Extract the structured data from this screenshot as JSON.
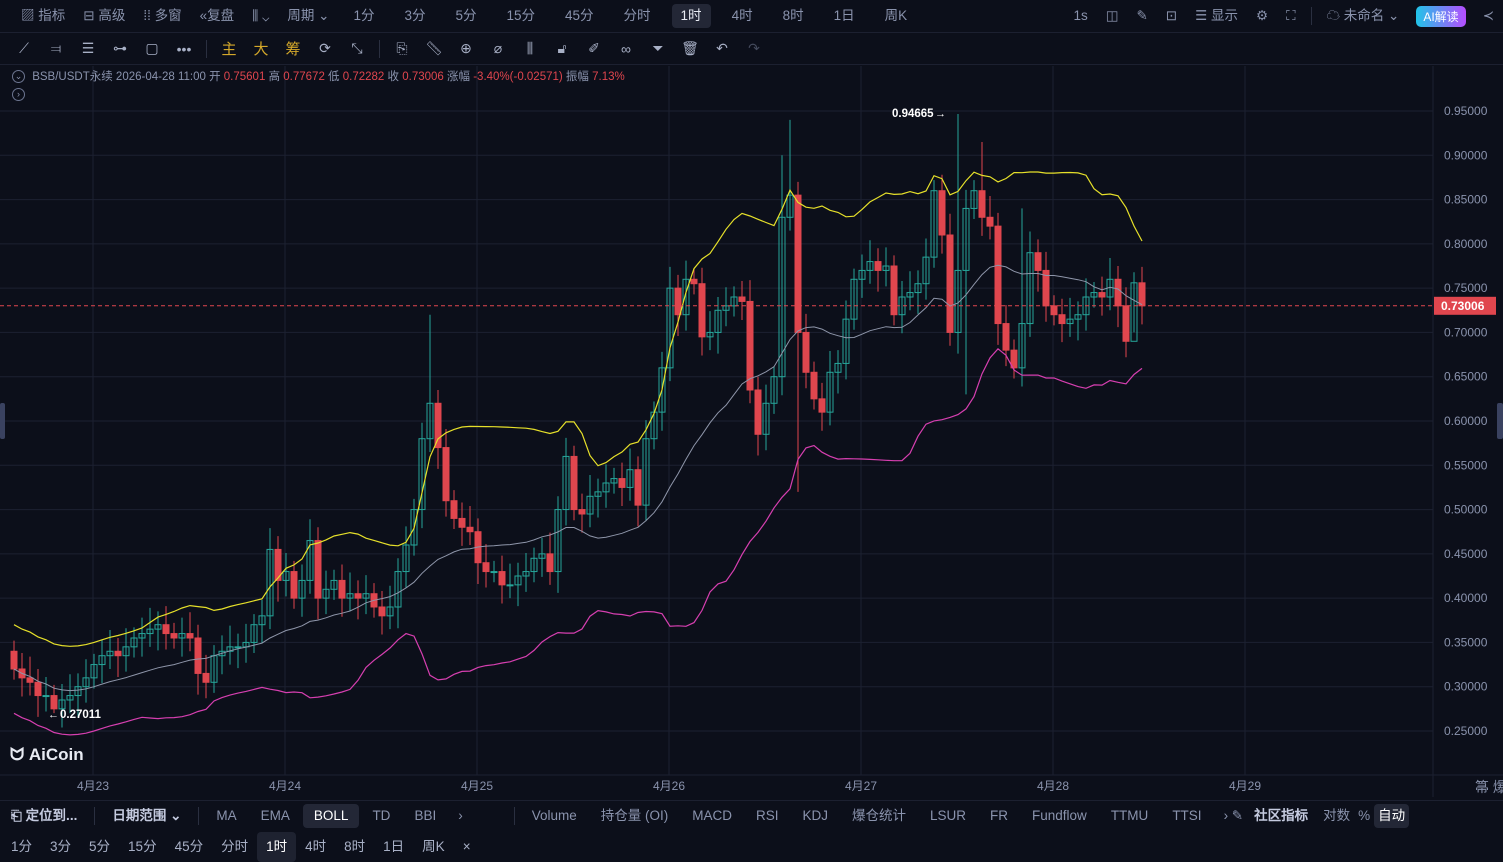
{
  "topbar": {
    "items": [
      "指标",
      "高级",
      "多窗",
      "复盘",
      "周期"
    ],
    "icons": [
      "chart-icon",
      "window-icon",
      "grid-icon",
      "replay-icon",
      "candle-type-icon"
    ],
    "periods": [
      "1分",
      "3分",
      "5分",
      "15分",
      "45分",
      "分时",
      "1时",
      "4时",
      "8时",
      "1日",
      "周K"
    ],
    "active_period": "1时",
    "refresh": "1s",
    "display": "显示",
    "layout_name": "未命名",
    "ai_button": "AI解读"
  },
  "drawing_tools": {
    "main": "主",
    "big": "大",
    "chips": "筹"
  },
  "info": {
    "symbol": "BSB/USDT永续",
    "datetime": "2026-04-28 11:00",
    "open_label": "开",
    "open": "0.75601",
    "high_label": "高",
    "high": "0.77672",
    "low_label": "低",
    "low": "0.72282",
    "close_label": "收",
    "close": "0.73006",
    "change_label": "涨幅",
    "change": "-3.40%(-0.02571)",
    "amp_label": "振幅",
    "amplitude": "7.13%"
  },
  "colors": {
    "up": "#26a69a",
    "down": "#e0464e",
    "boll_upper": "#e6e02a",
    "boll_mid": "#8f96aa",
    "boll_lower": "#d63fb0",
    "bg": "#0c0f1a"
  },
  "chart_data": {
    "type": "candlestick",
    "indicator": "BOLL(20,2)",
    "ylim": [
      0.22,
      0.98
    ],
    "yticks": [
      "0.95000",
      "0.90000",
      "0.85000",
      "0.80000",
      "0.75000",
      "0.70000",
      "0.65000",
      "0.60000",
      "0.55000",
      "0.50000",
      "0.45000",
      "0.40000",
      "0.35000",
      "0.30000",
      "0.25000"
    ],
    "xticks": [
      "4月23",
      "4月24",
      "4月25",
      "4月26",
      "4月27",
      "4月28",
      "4月29"
    ],
    "current_price": "0.73006",
    "max_label": "0.94665",
    "min_label": "0.27011",
    "first_open": 0.34,
    "closes": [
      0.32,
      0.31,
      0.305,
      0.29,
      0.29,
      0.275,
      0.285,
      0.29,
      0.3,
      0.31,
      0.325,
      0.335,
      0.34,
      0.335,
      0.345,
      0.355,
      0.36,
      0.365,
      0.37,
      0.36,
      0.355,
      0.36,
      0.355,
      0.315,
      0.305,
      0.335,
      0.34,
      0.345,
      0.345,
      0.35,
      0.37,
      0.38,
      0.455,
      0.42,
      0.43,
      0.4,
      0.42,
      0.465,
      0.4,
      0.41,
      0.42,
      0.4,
      0.405,
      0.4,
      0.405,
      0.39,
      0.38,
      0.39,
      0.43,
      0.46,
      0.5,
      0.58,
      0.62,
      0.57,
      0.51,
      0.49,
      0.48,
      0.475,
      0.44,
      0.43,
      0.43,
      0.415,
      0.415,
      0.425,
      0.43,
      0.445,
      0.45,
      0.43,
      0.5,
      0.56,
      0.5,
      0.495,
      0.515,
      0.52,
      0.53,
      0.535,
      0.525,
      0.545,
      0.505,
      0.58,
      0.61,
      0.66,
      0.75,
      0.72,
      0.76,
      0.755,
      0.695,
      0.7,
      0.725,
      0.73,
      0.74,
      0.735,
      0.635,
      0.585,
      0.62,
      0.65,
      0.83,
      0.855,
      0.7,
      0.655,
      0.625,
      0.61,
      0.655,
      0.665,
      0.715,
      0.76,
      0.77,
      0.78,
      0.77,
      0.775,
      0.72,
      0.74,
      0.745,
      0.755,
      0.785,
      0.86,
      0.81,
      0.7,
      0.77,
      0.84,
      0.86,
      0.83,
      0.82,
      0.71,
      0.68,
      0.66,
      0.71,
      0.79,
      0.77,
      0.73,
      0.72,
      0.71,
      0.715,
      0.72,
      0.74,
      0.745,
      0.74,
      0.76,
      0.73,
      0.69,
      0.75601,
      0.73006
    ],
    "high_overrides": {
      "52": 0.72,
      "96": 0.9,
      "97": 0.94,
      "118": 0.94665,
      "121": 0.915,
      "126": 0.84
    },
    "low_overrides": {
      "5": 0.27011,
      "98": 0.52,
      "119": 0.63,
      "140": 0.7
    }
  },
  "bottom": {
    "locate": "定位到...",
    "date_range": "日期范围",
    "indicators": [
      "MA",
      "EMA",
      "BOLL",
      "TD",
      "BBI"
    ],
    "active": "BOLL",
    "sub_indicators": [
      "Volume",
      "持仓量 (OI)",
      "MACD",
      "RSI",
      "KDJ",
      "爆仓统计",
      "LSUR",
      "FR",
      "Fundflow",
      "TTMU",
      "TTSI"
    ],
    "community": "社区指标",
    "log": "对数",
    "percent": "%",
    "auto": "自动"
  },
  "period_bar": {
    "items": [
      "1分",
      "3分",
      "5分",
      "15分",
      "45分",
      "分时",
      "1时",
      "4时",
      "8时",
      "1日",
      "周K"
    ],
    "active": "1时",
    "close": "×"
  },
  "brand": "AiCoin"
}
